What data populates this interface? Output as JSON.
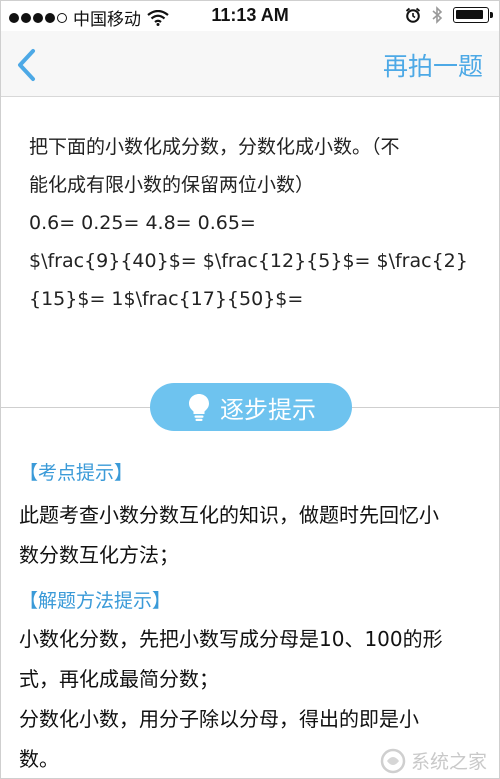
{
  "status_bar": {
    "carrier": "中国移动",
    "time": "11:13 AM",
    "battery_level": 0.9,
    "icons": [
      "signal-dots-icon",
      "wifi-icon",
      "alarm-icon",
      "bluetooth-icon",
      "battery-icon"
    ]
  },
  "nav": {
    "back_icon": "chevron-left-icon",
    "retake_label": "再拍一题"
  },
  "question": {
    "lines": [
      "把下面的小数化成分数，分数化成小数。（不",
      "能化成有限小数的保留两位小数）",
      "0.6=    0.25=    4.8=    0.65=",
      "$\\frac{9}{40}$=    $\\frac{12}{5}$=    $\\frac{2}",
      "{15}$=    1$\\frac{17}{50}$="
    ]
  },
  "hint_button": {
    "label": "逐步提示",
    "icon": "lightbulb-icon"
  },
  "hints": {
    "point_title": "【考点提示】",
    "point_body": [
      "此题考查小数分数互化的知识，做题时先回忆小",
      "数分数互化方法；"
    ],
    "method_title": "【解题方法提示】",
    "method_body": [
      "小数化分数，先把小数写成分母是10、100的形",
      "式，再化成最简分数；",
      "分数化小数，用分子除以分母，得出的即是小",
      "数。"
    ]
  },
  "watermark": {
    "text": "系统之家",
    "icon": "watermark-logo-icon"
  },
  "colors": {
    "accent": "#4da9e6",
    "hint_button_bg": "#6ec3ef",
    "hint_title": "#3a9ad8"
  }
}
